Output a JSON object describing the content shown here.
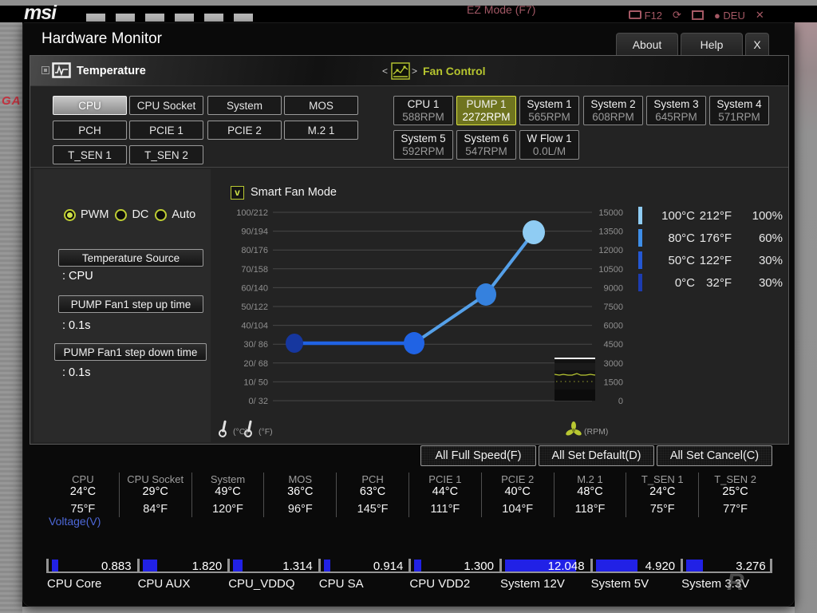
{
  "background": {
    "logo": "msi",
    "ez_mode_label": "EZ Mode (F7)",
    "screenshot_key": "F12",
    "refresh_glyph": "⟳",
    "language": "DEU",
    "close_glyph": "✕",
    "side_text": "GA",
    "watermark": "R"
  },
  "dialog": {
    "title": "Hardware Monitor",
    "about_label": "About",
    "help_label": "Help",
    "close_label": "X"
  },
  "temperature_section": {
    "title": "Temperature",
    "sensors": [
      {
        "label": "CPU",
        "selected": true
      },
      {
        "label": "CPU Socket",
        "selected": false
      },
      {
        "label": "System",
        "selected": false
      },
      {
        "label": "MOS",
        "selected": false
      },
      {
        "label": "PCH",
        "selected": false
      },
      {
        "label": "PCIE 1",
        "selected": false
      },
      {
        "label": "PCIE 2",
        "selected": false
      },
      {
        "label": "M.2 1",
        "selected": false
      },
      {
        "label": "T_SEN 1",
        "selected": false
      },
      {
        "label": "T_SEN 2",
        "selected": false
      }
    ]
  },
  "fan_section": {
    "title": "Fan Control",
    "prev_glyph": "<",
    "next_glyph": ">",
    "fans": [
      {
        "name": "CPU 1",
        "value": "588RPM",
        "selected": false
      },
      {
        "name": "PUMP 1",
        "value": "2272RPM",
        "selected": true
      },
      {
        "name": "System 1",
        "value": "565RPM",
        "selected": false
      },
      {
        "name": "System 2",
        "value": "608RPM",
        "selected": false
      },
      {
        "name": "System 3",
        "value": "645RPM",
        "selected": false
      },
      {
        "name": "System 4",
        "value": "571RPM",
        "selected": false
      },
      {
        "name": "System 5",
        "value": "592RPM",
        "selected": false
      },
      {
        "name": "System 6",
        "value": "547RPM",
        "selected": false
      },
      {
        "name": "W Flow 1",
        "value": "0.0L/M",
        "selected": false
      }
    ]
  },
  "fan_controls": {
    "modes": [
      {
        "label": "PWM",
        "selected": true
      },
      {
        "label": "DC",
        "selected": false
      },
      {
        "label": "Auto",
        "selected": false
      }
    ],
    "fields": [
      {
        "button_label": "Temperature Source",
        "value": ": CPU"
      },
      {
        "button_label": "PUMP Fan1 step up time",
        "value": ": 0.1s"
      },
      {
        "button_label": "PUMP Fan1 step down time",
        "value": ": 0.1s"
      }
    ]
  },
  "chart_data": {
    "type": "line",
    "title": "Smart Fan Mode",
    "checkbox_checked": true,
    "check_glyph": "v",
    "left_axis_ticks": [
      "100/212",
      "90/194",
      "80/176",
      "70/158",
      "60/140",
      "50/122",
      "40/104",
      "30/ 86",
      "20/ 68",
      "10/ 50",
      "0/ 32"
    ],
    "right_axis_ticks": [
      "15000",
      "13500",
      "12000",
      "10500",
      "9000",
      "7500",
      "6000",
      "4500",
      "3000",
      "1500",
      "0"
    ],
    "x_range_celsius": [
      0,
      100
    ],
    "right_axis_range_rpm": [
      0,
      15000
    ],
    "points": [
      {
        "temp_c": 0,
        "fan_percent": 30
      },
      {
        "temp_c": 50,
        "fan_percent": 30
      },
      {
        "temp_c": 80,
        "fan_percent": 60
      },
      {
        "temp_c": 100,
        "fan_percent": 100
      }
    ],
    "point_colors": [
      "#16379f",
      "#2063e4",
      "#3581de",
      "#8fccf3"
    ],
    "line_colors": [
      "#2063e4",
      "#55a0e8"
    ],
    "footer_units": {
      "celsius": "(°C)",
      "fahrenheit": "(°F)",
      "rpm": "(RPM)"
    }
  },
  "legend": {
    "rows": [
      {
        "celsius": "100°C",
        "fahrenheit": "212°F",
        "percent": "100%",
        "color": "#8fccf3"
      },
      {
        "celsius": "80°C",
        "fahrenheit": "176°F",
        "percent": "60%",
        "color": "#3e8ee8"
      },
      {
        "celsius": "50°C",
        "fahrenheit": "122°F",
        "percent": "30%",
        "color": "#2458d4"
      },
      {
        "celsius": "0°C",
        "fahrenheit": "32°F",
        "percent": "30%",
        "color": "#1c3cb0"
      }
    ]
  },
  "action_buttons": [
    "All Full Speed(F)",
    "All Set Default(D)",
    "All Set Cancel(C)"
  ],
  "temperature_readings": [
    {
      "name": "CPU",
      "celsius": "24°C",
      "fahrenheit": "75°F"
    },
    {
      "name": "CPU Socket",
      "celsius": "29°C",
      "fahrenheit": "84°F"
    },
    {
      "name": "System",
      "celsius": "49°C",
      "fahrenheit": "120°F"
    },
    {
      "name": "MOS",
      "celsius": "36°C",
      "fahrenheit": "96°F"
    },
    {
      "name": "PCH",
      "celsius": "63°C",
      "fahrenheit": "145°F"
    },
    {
      "name": "PCIE 1",
      "celsius": "44°C",
      "fahrenheit": "111°F"
    },
    {
      "name": "PCIE 2",
      "celsius": "40°C",
      "fahrenheit": "104°F"
    },
    {
      "name": "M.2 1",
      "celsius": "48°C",
      "fahrenheit": "118°F"
    },
    {
      "name": "T_SEN 1",
      "celsius": "24°C",
      "fahrenheit": "75°F"
    },
    {
      "name": "T_SEN 2",
      "celsius": "25°C",
      "fahrenheit": "77°F"
    }
  ],
  "voltage_section": {
    "title": "Voltage(V)",
    "accent_color": "#2121e6",
    "rails": [
      {
        "name": "CPU Core",
        "value": "0.883",
        "fraction": 0.08
      },
      {
        "name": "CPU AUX",
        "value": "1.820",
        "fraction": 0.17
      },
      {
        "name": "CPU_VDDQ",
        "value": "1.314",
        "fraction": 0.12
      },
      {
        "name": "CPU SA",
        "value": "0.914",
        "fraction": 0.08
      },
      {
        "name": "CPU VDD2",
        "value": "1.300",
        "fraction": 0.09
      },
      {
        "name": "System 12V",
        "value": "12.048",
        "fraction": 0.86
      },
      {
        "name": "System 5V",
        "value": "4.920",
        "fraction": 0.5
      },
      {
        "name": "System 3.3V",
        "value": "3.276",
        "fraction": 0.2
      }
    ]
  }
}
